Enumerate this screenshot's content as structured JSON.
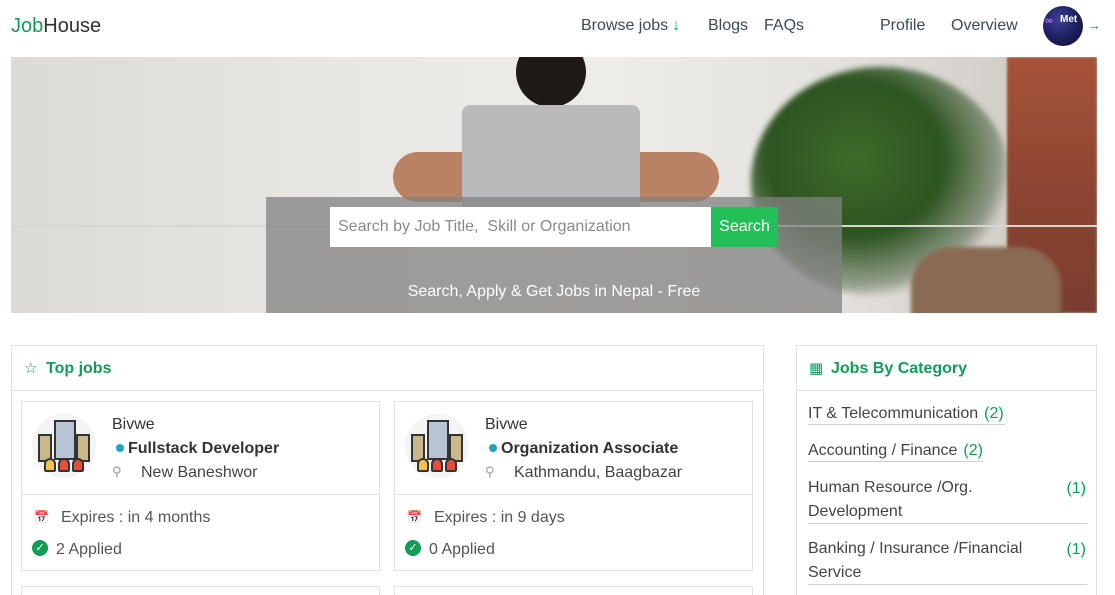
{
  "navbar": {
    "brand_accent": "Job",
    "brand_rest": "House",
    "links": {
      "browse_jobs": "Browse jobs",
      "blogs": "Blogs",
      "faqs": "FAQs",
      "profile": "Profile",
      "overview": "Overview"
    },
    "avatar_text": "Met",
    "icons": {
      "browse_arrow": "arrow-down-icon",
      "logout": "logout-arrow-icon"
    }
  },
  "hero": {
    "search_placeholder": "Search by Job Title,  Skill or Organization",
    "search_button": "Search",
    "tagline": "Search, Apply & Get Jobs in Nepal - Free"
  },
  "top_jobs": {
    "title": "Top jobs",
    "icon": "star-icon",
    "jobs": [
      {
        "company": "Bivwe",
        "title": "Fullstack Developer",
        "location": "New Baneshwor",
        "expires": "Expires : in 4 months",
        "applied": "2 Applied"
      },
      {
        "company": "Bivwe",
        "title": "Organization Associate",
        "location": "Kathmandu, Baagbazar",
        "expires": "Expires : in 9 days",
        "applied": "0 Applied"
      }
    ]
  },
  "categories": {
    "title": "Jobs By Category",
    "icon": "grid-icon",
    "items": [
      {
        "line1": "IT & Telecommunication",
        "count": "(2)"
      },
      {
        "line1": "Accounting / Finance",
        "count": "(2)"
      },
      {
        "line1": "Human Resource /Org.",
        "line2": "Development",
        "count": "(1)"
      },
      {
        "line1": "Banking / Insurance /Financial",
        "line2": "Service",
        "count": "(1)"
      }
    ]
  },
  "colors": {
    "brand_green": "#0f9d58",
    "search_button": "#23c05a",
    "job_dot": "#1da1c4"
  }
}
